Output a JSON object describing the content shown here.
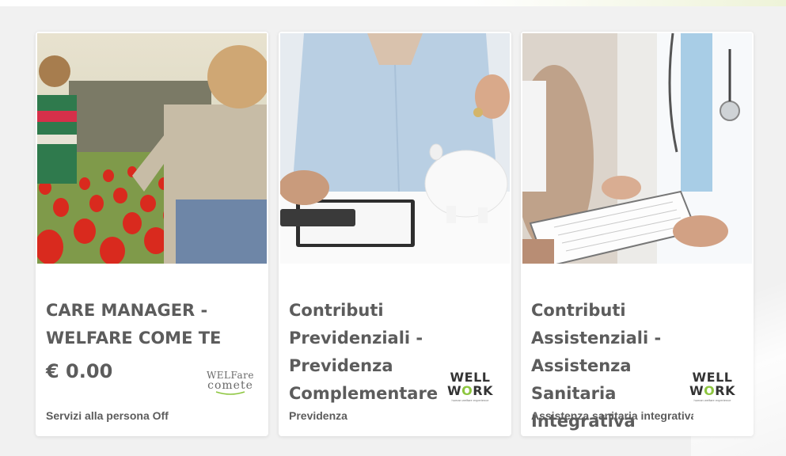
{
  "cards": [
    {
      "title": "CARE MANAGER -\nWELFARE COME TE",
      "price": "€ 0.00",
      "category": "Servizi alla persona Off",
      "logo": {
        "line1": "WELFare",
        "line2": "comete"
      }
    },
    {
      "title": "Contributi\nPrevidenziali -\nPrevidenza\nComplementare",
      "category": "Previdenza",
      "logo": {
        "line1": "WELL",
        "line2_a": "W",
        "line2_o": "O",
        "line2_b": "RK",
        "tagline": "human welfare experience"
      }
    },
    {
      "title": "Contributi\nAssistenziali -\nAssistenza Sanitaria\nIntegrativa",
      "category": "Assistenza sanitaria integrativa",
      "logo": {
        "line1": "WELL",
        "line2_a": "W",
        "line2_o": "O",
        "line2_b": "RK",
        "tagline": "human welfare experience"
      }
    }
  ],
  "colors": {
    "text": "#5c5c5c",
    "background": "#f1f1f1",
    "card": "#ffffff",
    "logo_accent": "#8dc63f"
  }
}
